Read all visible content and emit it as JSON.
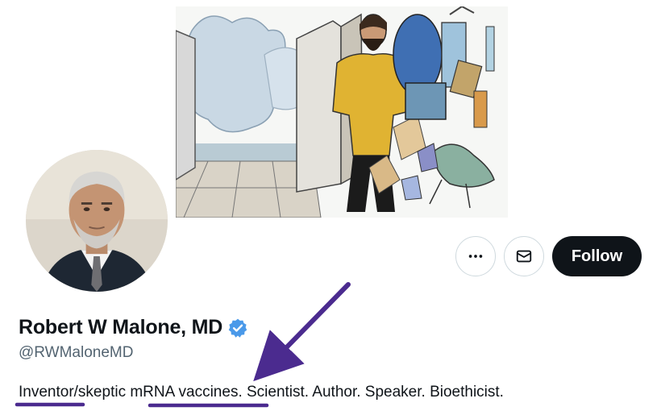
{
  "profile": {
    "display_name": "Robert W Malone, MD",
    "handle": "@RWMaloneMD",
    "verified": true,
    "bio": "Inventor/skeptic mRNA vaccines. Scientist. Author. Speaker. Bioethicist."
  },
  "actions": {
    "more_icon": "more-horizontal-icon",
    "message_icon": "envelope-icon",
    "follow_label": "Follow"
  },
  "colors": {
    "verified": "#4a99e9",
    "follow_bg": "#0f1419",
    "annotation": "#4b2b8f",
    "handle_text": "#536471"
  }
}
